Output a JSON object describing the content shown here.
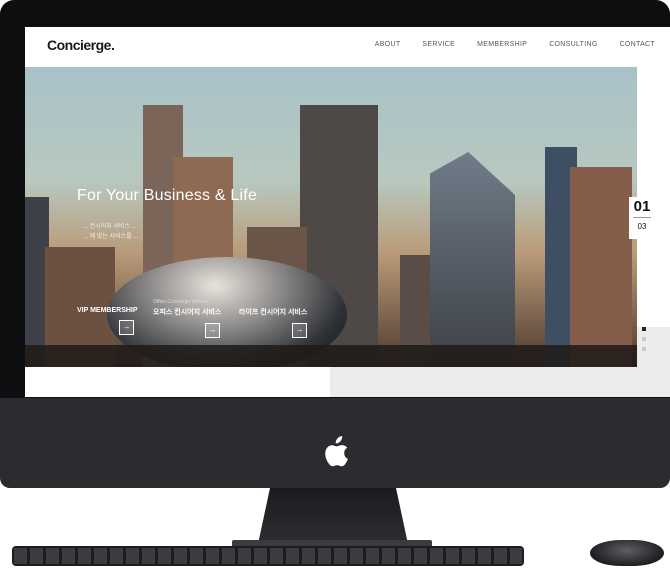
{
  "brand": "Concierge.",
  "nav": {
    "about": "ABOUT",
    "service": "SERVICE",
    "membership": "MEMBERSHIP",
    "consulting": "CONSULTING",
    "contact": "CONTACT"
  },
  "hero": {
    "headline": "For Your Business & Life",
    "sub_line1": "... 컨시어지 서비스 ...",
    "sub_line2": "... 에 맞는 서비스를 ..."
  },
  "services": [
    {
      "tiny": "",
      "label": "VIP MEMBERSHIP",
      "arrow": "→"
    },
    {
      "tiny": "Office Concierge Service",
      "label": "오피스 컨시어지 서비스",
      "arrow": "→"
    },
    {
      "tiny": "",
      "label": "라이프 컨시어지 서비스",
      "arrow": "→"
    }
  ],
  "slider": {
    "current": "01",
    "total": "03",
    "active_dot": 0,
    "dot_count": 3
  },
  "colors": {
    "bezel": "#0d0e10",
    "chin": "#2b2c2f",
    "panel": "#ececec"
  },
  "icons": [
    "apple-logo-icon",
    "arrow-right-icon"
  ]
}
